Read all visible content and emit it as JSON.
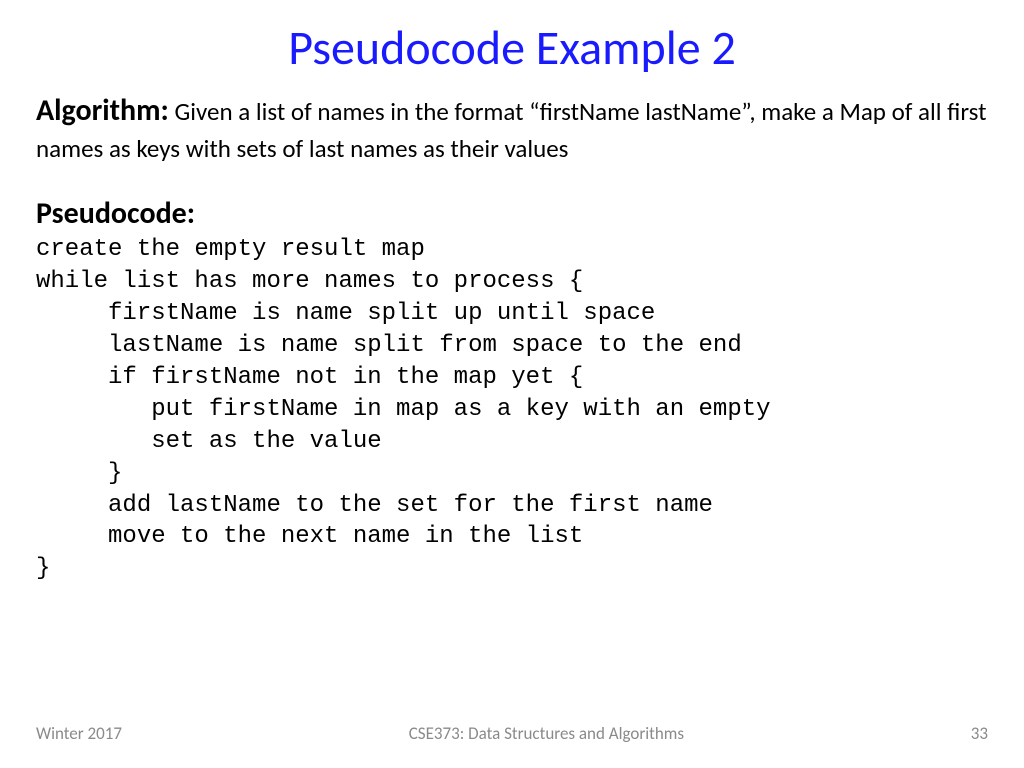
{
  "title": "Pseudocode Example 2",
  "algorithm": {
    "label": "Algorithm:",
    "description": " Given a list of names in the format “firstName lastName”, make a Map of all first names as keys with sets of last names as their values"
  },
  "pseudocode": {
    "label": "Pseudocode:",
    "lines": [
      "create the empty result map",
      "while list has more names to process {",
      "     firstName is name split up until space",
      "     lastName is name split from space to the end",
      "     if firstName not in the map yet {",
      "        put firstName in map as a key with an empty",
      "        set as the value",
      "     }",
      "     add lastName to the set for the first name",
      "     move to the next name in the list",
      "}"
    ]
  },
  "footer": {
    "term": "Winter 2017",
    "course": "CSE373: Data Structures and Algorithms",
    "page": "33"
  }
}
